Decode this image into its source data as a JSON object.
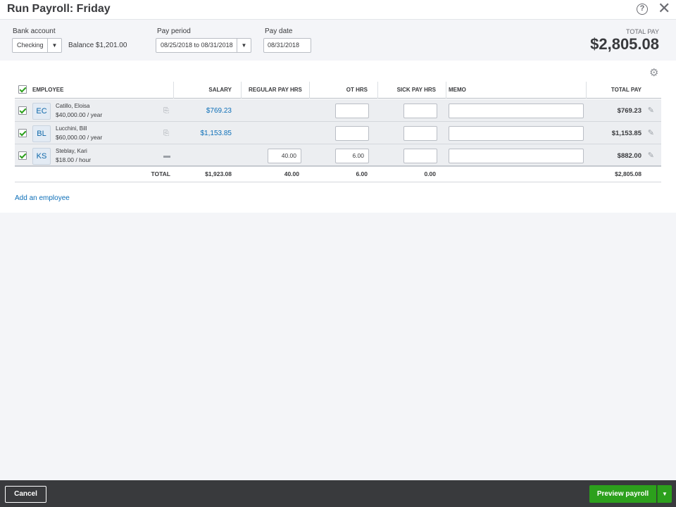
{
  "window": {
    "title": "Run Payroll: Friday"
  },
  "header": {
    "bank_account_label": "Bank account",
    "bank_account_value": "Checking",
    "balance": "Balance $1,201.00",
    "pay_period_label": "Pay period",
    "pay_period_value": "08/25/2018 to 08/31/2018",
    "pay_date_label": "Pay date",
    "pay_date_value": "08/31/2018",
    "total_pay_label": "TOTAL PAY",
    "total_pay_amount": "$2,805.08"
  },
  "table": {
    "columns": {
      "employee": "EMPLOYEE",
      "salary": "SALARY",
      "regular_pay_hrs": "REGULAR PAY HRS",
      "ot_hrs": "OT HRS",
      "sick_pay_hrs": "SICK PAY HRS",
      "memo": "MEMO",
      "total_pay": "TOTAL PAY"
    },
    "rows": [
      {
        "initials": "EC",
        "name": "Catillo, Eloisa",
        "rate": "$40,000.00 / year",
        "pay_method_icon": "direct-deposit-icon",
        "salary": "$769.23",
        "regular_hrs": "",
        "ot_hrs": "",
        "sick_hrs": "",
        "memo": "",
        "total": "$769.23"
      },
      {
        "initials": "BL",
        "name": "Lucchini, Bill",
        "rate": "$60,000.00 / year",
        "pay_method_icon": "direct-deposit-icon",
        "salary": "$1,153.85",
        "regular_hrs": "",
        "ot_hrs": "",
        "sick_hrs": "",
        "memo": "",
        "total": "$1,153.85"
      },
      {
        "initials": "KS",
        "name": "Steblay, Kari",
        "rate": "$18.00 / hour",
        "pay_method_icon": "paper-check-icon",
        "salary": "",
        "regular_hrs": "40.00",
        "ot_hrs": "6.00",
        "sick_hrs": "",
        "memo": "",
        "total": "$882.00"
      }
    ],
    "totals": {
      "label": "TOTAL",
      "salary": "$1,923.08",
      "regular_hrs": "40.00",
      "ot_hrs": "6.00",
      "sick_hrs": "0.00",
      "total": "$2,805.08"
    }
  },
  "add_employee_link": "Add an employee",
  "footer": {
    "cancel_label": "Cancel",
    "preview_label": "Preview payroll"
  },
  "colors": {
    "accent_green": "#2ca01c",
    "link_blue": "#0d6fb8",
    "footer_bg": "#393a3d"
  }
}
